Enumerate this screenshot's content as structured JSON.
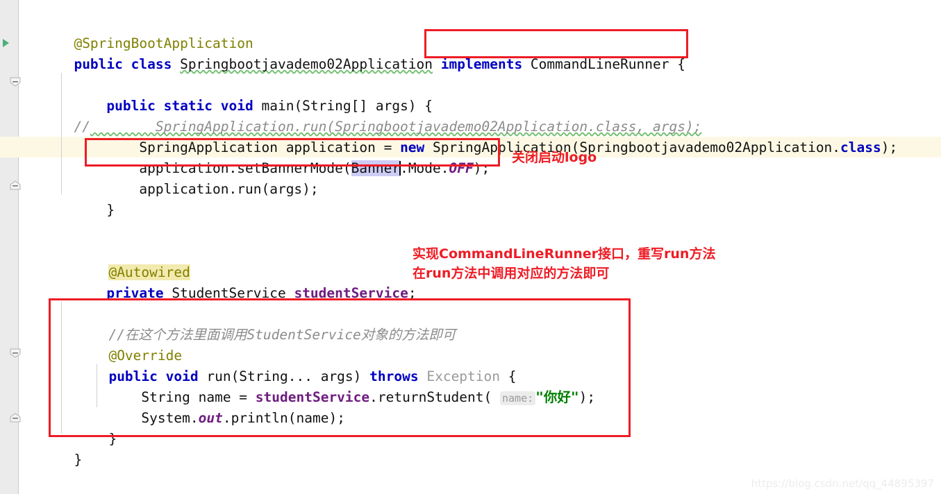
{
  "editor": {
    "language": "java",
    "background": "#ffffff",
    "gutter_color": "#ebebeb",
    "current_line_highlight": "#fcf8e4",
    "annotation_color": "#ee1c25",
    "selection_color": "#ccccf5"
  },
  "code": {
    "line_01": "@SpringBootApplication",
    "line_02_a": "public class ",
    "line_02_b": "Springbootjavademo02Application",
    "line_02_c": " ",
    "line_02_d": "implements",
    "line_02_e": " CommandLineRunner",
    "line_02_f": " {",
    "line_04_a": "    public static void ",
    "line_04_b": "main(String[] args) {",
    "line_05_slash": "//",
    "line_05_text": "        SpringApplication.run(Springbootjavademo02Application.class, args);",
    "line_06_a": "        SpringApplication application = ",
    "line_06_b": "new",
    "line_06_c": " SpringApplication(Springbootjavademo02Application.",
    "line_06_d": "class",
    "line_06_e": ");",
    "line_07_a": "        application.setBannerMode(",
    "line_07_b": "Banner",
    "line_07_c": ".Mode.",
    "line_07_d": "OFF",
    "line_07_e": ");",
    "line_08": "        application.run(args);",
    "line_09": "    }",
    "line_12": "@Autowired",
    "line_13_a": "    private ",
    "line_13_b": "StudentService ",
    "line_13_c": "studentService",
    "line_13_d": ";",
    "line_15": "//在这个方法里面调用StudentService对象的方法即可",
    "line_16": "@Override",
    "line_17_a": "public void ",
    "line_17_b": "run(String... args) ",
    "line_17_c": "throws",
    "line_17_d": " Exception",
    "line_17_e": " {",
    "line_18_a": "    String name = ",
    "line_18_b": "studentService",
    "line_18_c": ".returnStudent( ",
    "line_18_hint": "name:",
    "line_18_d": "\"你好\"",
    "line_18_e": ");",
    "line_19_a": "    System.",
    "line_19_b": "out",
    "line_19_c": ".println(name);",
    "line_20": "}",
    "line_21": "}"
  },
  "annotations": {
    "note_1": "关闭启动logo",
    "note_2_line1": "实现CommandLineRunner接口，重写run方法",
    "note_2_line2": "在run方法中调用对应的方法即可",
    "box_1_target": "implements CommandLineRunner",
    "box_2_target": "application.setBannerMode(Banner.Mode.OFF);",
    "box_3_target": "run method body"
  },
  "gutter": {
    "run_marker_tooltip": "run-class-marker",
    "fold_markers": [
      "collapse-method-main",
      "collapse-region",
      "collapse-method-run",
      "collapse-class"
    ]
  },
  "watermark": {
    "text": "https://blog.csdn.net/qq_44895397"
  }
}
